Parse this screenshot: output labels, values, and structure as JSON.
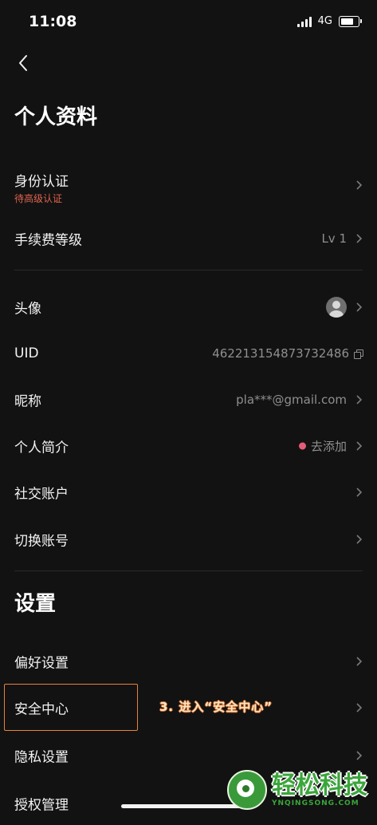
{
  "status_bar": {
    "time": "11:08",
    "network": "4G",
    "battery_level": 0.85
  },
  "profile": {
    "title": "个人资料",
    "identity": {
      "label": "身份认证",
      "status": "待高级认证"
    },
    "fee_level": {
      "label": "手续费等级",
      "value": "Lv 1"
    },
    "avatar": {
      "label": "头像"
    },
    "uid": {
      "label": "UID",
      "value": "462213154873732486"
    },
    "nickname": {
      "label": "昵称",
      "value": "pla***@gmail.com"
    },
    "bio": {
      "label": "个人简介",
      "value": "去添加"
    },
    "social": {
      "label": "社交账户"
    },
    "switch_account": {
      "label": "切换账号"
    }
  },
  "settings": {
    "title": "设置",
    "preferences": {
      "label": "偏好设置"
    },
    "security_center": {
      "label": "安全中心"
    },
    "privacy": {
      "label": "隐私设置"
    },
    "authorization": {
      "label": "授权管理"
    }
  },
  "annotation": {
    "text": "3. 进入“安全中心”"
  },
  "watermark": {
    "main": "轻松科技",
    "sub": "YNQINGSONG.COM"
  },
  "colors": {
    "background": "#121212",
    "warning": "#e0644f",
    "highlight": "#e8823a",
    "dot": "#e35d78"
  }
}
